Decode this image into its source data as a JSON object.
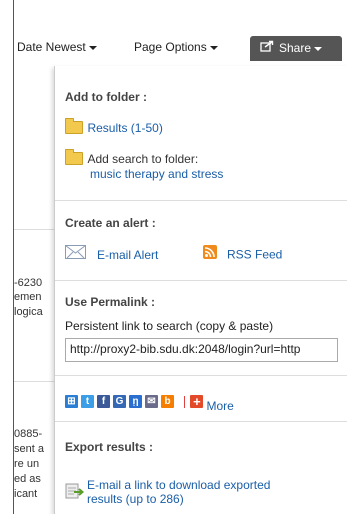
{
  "toolbar": {
    "sort_label": "Date Newest",
    "page_options_label": "Page Options",
    "share_label": "Share"
  },
  "background_fragments": [
    "-6230",
    "emen",
    "logica",
    "0885-",
    "sent a",
    "re un",
    "ed as",
    "icant"
  ],
  "panel": {
    "add_to_folder": {
      "title": "Add to folder :",
      "results_link": "Results (1-50)",
      "add_search_label": "Add search to folder:",
      "search_name": "music therapy and stress"
    },
    "create_alert": {
      "title": "Create an alert :",
      "email_alert": "E-mail Alert",
      "rss_feed": "RSS Feed"
    },
    "permalink": {
      "title": "Use Permalink :",
      "description": "Persistent link to search (copy & paste)",
      "url": "http://proxy2-bib.sdu.dk:2048/login?url=http"
    },
    "social": {
      "icons": [
        "share-icon",
        "twitter-icon",
        "facebook-icon",
        "google-icon",
        "delicious-icon",
        "email-icon",
        "blogger-icon"
      ],
      "more_label": "More"
    },
    "export": {
      "title": "Export results :",
      "link_line1": "E-mail a link to download exported",
      "link_line2": "results (up to 286)"
    }
  }
}
